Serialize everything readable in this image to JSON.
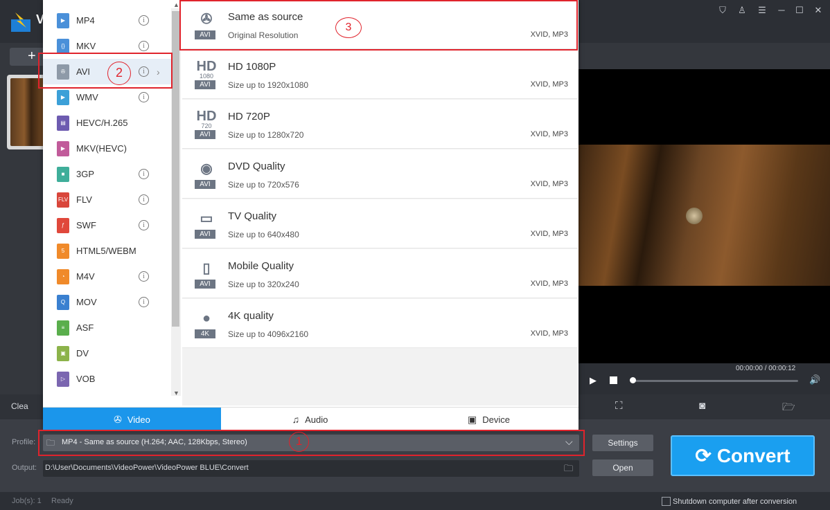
{
  "app": {
    "logo_letter": "V"
  },
  "window_controls": [
    "cart-icon",
    "user-icon",
    "menu-icon",
    "minimize-icon",
    "maximize-icon",
    "close-icon"
  ],
  "toolbar": {
    "add_label": "+",
    "clear_label": "Clea"
  },
  "formats": [
    {
      "label": "MP4",
      "color": "#4a90d9",
      "glyph": "▶",
      "info": true
    },
    {
      "label": "MKV",
      "color": "#4a90d9",
      "glyph": "{}",
      "info": true
    },
    {
      "label": "AVI",
      "color": "#8e9aa8",
      "glyph": "✇",
      "info": true,
      "selected": true
    },
    {
      "label": "WMV",
      "color": "#3ca0d8",
      "glyph": "▶",
      "info": true
    },
    {
      "label": "HEVC/H.265",
      "color": "#6d5bb0",
      "glyph": "▤",
      "info": false
    },
    {
      "label": "MKV(HEVC)",
      "color": "#c15b9a",
      "glyph": "▶",
      "info": false
    },
    {
      "label": "3GP",
      "color": "#3fae9a",
      "glyph": "■",
      "info": true
    },
    {
      "label": "FLV",
      "color": "#d9463b",
      "glyph": "FLV",
      "info": true
    },
    {
      "label": "SWF",
      "color": "#e0483b",
      "glyph": "ƒ",
      "info": true
    },
    {
      "label": "HTML5/WEBM",
      "color": "#f08a2a",
      "glyph": "5",
      "info": false
    },
    {
      "label": "M4V",
      "color": "#f08a2a",
      "glyph": "◔",
      "info": true
    },
    {
      "label": "MOV",
      "color": "#3a80d0",
      "glyph": "Q",
      "info": true
    },
    {
      "label": "ASF",
      "color": "#5aae4c",
      "glyph": "≡",
      "info": false
    },
    {
      "label": "DV",
      "color": "#8cb34a",
      "glyph": "▣",
      "info": false
    },
    {
      "label": "VOB",
      "color": "#7b66b0",
      "glyph": "▷",
      "info": false
    }
  ],
  "info_glyph": "i",
  "presets": [
    {
      "title": "Same as source",
      "subtitle": "Original Resolution",
      "codec": "XVID, MP3",
      "badge": "AVI",
      "icon": "film-reel-icon",
      "glyph": "✇"
    },
    {
      "title": "HD 1080P",
      "subtitle": "Size up to 1920x1080",
      "codec": "XVID, MP3",
      "badge": "AVI",
      "icon": "hd-1080-icon",
      "glyph": "HD"
    },
    {
      "title": "HD 720P",
      "subtitle": "Size up to 1280x720",
      "codec": "XVID, MP3",
      "badge": "AVI",
      "icon": "hd-720-icon",
      "glyph": "HD"
    },
    {
      "title": "DVD Quality",
      "subtitle": "Size up to 720x576",
      "codec": "XVID, MP3",
      "badge": "AVI",
      "icon": "disc-icon",
      "glyph": "◉"
    },
    {
      "title": "TV Quality",
      "subtitle": "Size up to 640x480",
      "codec": "XVID, MP3",
      "badge": "AVI",
      "icon": "tv-icon",
      "glyph": "▭"
    },
    {
      "title": "Mobile Quality",
      "subtitle": "Size up to 320x240",
      "codec": "XVID, MP3",
      "badge": "AVI",
      "icon": "mobile-icon",
      "glyph": "▯"
    },
    {
      "title": "4K quality",
      "subtitle": "Size up to 4096x2160",
      "codec": "XVID, MP3",
      "badge": "4K",
      "icon": "camera-icon",
      "glyph": "●"
    }
  ],
  "hd_sub": {
    "p1080": "1080",
    "p720": "720"
  },
  "tabs": [
    {
      "label": "Video",
      "icon": "film-reel-icon",
      "glyph": "✇",
      "active": true
    },
    {
      "label": "Audio",
      "icon": "headphones-icon",
      "glyph": "♫",
      "active": false
    },
    {
      "label": "Device",
      "icon": "device-icon",
      "glyph": "▣",
      "active": false
    }
  ],
  "player": {
    "time": "00:00:00 / 00:00:12",
    "progress": 0.0
  },
  "profile": {
    "label": "Profile:",
    "value": "MP4 - Same as source (H.264; AAC, 128Kbps, Stereo)"
  },
  "output": {
    "label": "Output:",
    "value": "D:\\User\\Documents\\VideoPower\\VideoPower BLUE\\Convert"
  },
  "buttons": {
    "settings": "Settings",
    "open": "Open",
    "convert": "Convert"
  },
  "status": {
    "jobs": "Job(s): 1",
    "ready": "Ready",
    "shutdown": "Shutdown computer after conversion"
  },
  "annotations": {
    "one": "1",
    "two": "2",
    "three": "3"
  },
  "colors": {
    "accent": "#1b96eb",
    "annotation": "#e0232c",
    "convert": "#1a9ff0"
  }
}
